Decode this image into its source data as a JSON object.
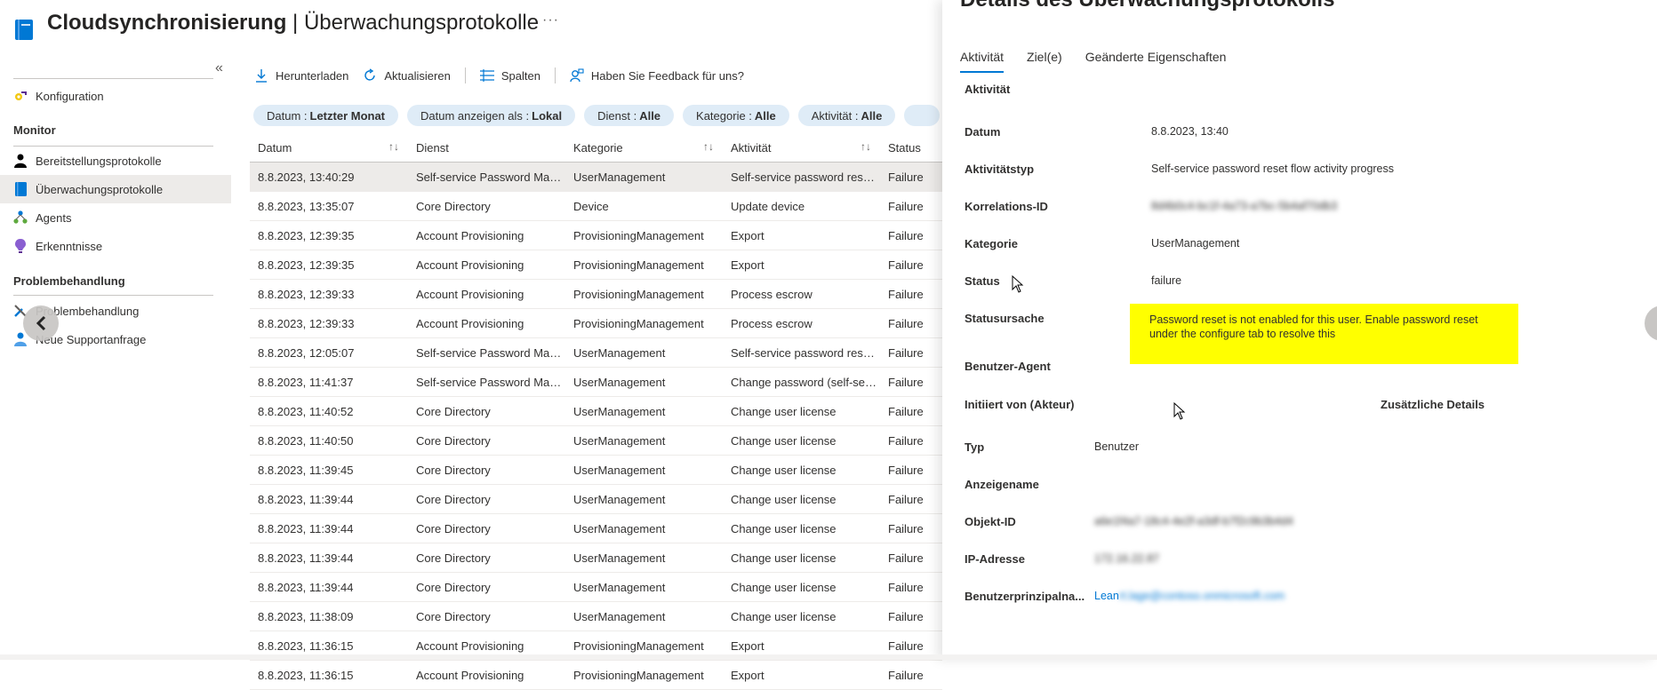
{
  "header": {
    "title_bold": "Cloudsynchronisierung",
    "title_sep": " | ",
    "title_rest": "Überwachungsprotokolle",
    "more": "···"
  },
  "nav": {
    "collapse": "«",
    "items_top": [
      {
        "label": "Konfiguration",
        "icon": "gear-key-icon"
      }
    ],
    "monitor_head": "Monitor",
    "monitor_items": [
      {
        "label": "Bereitstellungsprotokolle",
        "icon": "person-icon"
      },
      {
        "label": "Überwachungsprotokolle",
        "icon": "book-icon",
        "active": true
      },
      {
        "label": "Agents",
        "icon": "agents-icon"
      },
      {
        "label": "Erkenntnisse",
        "icon": "lightbulb-icon"
      }
    ],
    "trouble_head": "Problembehandlung",
    "trouble_items": [
      {
        "label": "Problembehandlung",
        "icon": "wrench-icon"
      },
      {
        "label": "Neue Supportanfrage",
        "icon": "support-person-icon"
      }
    ]
  },
  "toolbar": {
    "download": "Herunterladen",
    "refresh": "Aktualisieren",
    "columns": "Spalten",
    "feedback": "Haben Sie Feedback für uns?"
  },
  "filters": [
    {
      "key": "Datum : ",
      "value": "Letzter Monat"
    },
    {
      "key": "Datum anzeigen als : ",
      "value": "Lokal"
    },
    {
      "key": "Dienst : ",
      "value": "Alle"
    },
    {
      "key": "Kategorie : ",
      "value": "Alle"
    },
    {
      "key": "Aktivität : ",
      "value": "Alle"
    }
  ],
  "table": {
    "headers": [
      "Datum",
      "Dienst",
      "Kategorie",
      "Aktivität",
      "Status"
    ],
    "rows": [
      [
        "8.8.2023, 13:40:29",
        "Self-service Password Mana...",
        "UserManagement",
        "Self-service password reset...",
        "Failure"
      ],
      [
        "8.8.2023, 13:35:07",
        "Core Directory",
        "Device",
        "Update device",
        "Failure"
      ],
      [
        "8.8.2023, 12:39:35",
        "Account Provisioning",
        "ProvisioningManagement",
        "Export",
        "Failure"
      ],
      [
        "8.8.2023, 12:39:35",
        "Account Provisioning",
        "ProvisioningManagement",
        "Export",
        "Failure"
      ],
      [
        "8.8.2023, 12:39:33",
        "Account Provisioning",
        "ProvisioningManagement",
        "Process escrow",
        "Failure"
      ],
      [
        "8.8.2023, 12:39:33",
        "Account Provisioning",
        "ProvisioningManagement",
        "Process escrow",
        "Failure"
      ],
      [
        "8.8.2023, 12:05:07",
        "Self-service Password Mana...",
        "UserManagement",
        "Self-service password reset...",
        "Failure"
      ],
      [
        "8.8.2023, 11:41:37",
        "Self-service Password Mana...",
        "UserManagement",
        "Change password (self-serv...",
        "Failure"
      ],
      [
        "8.8.2023, 11:40:52",
        "Core Directory",
        "UserManagement",
        "Change user license",
        "Failure"
      ],
      [
        "8.8.2023, 11:40:50",
        "Core Directory",
        "UserManagement",
        "Change user license",
        "Failure"
      ],
      [
        "8.8.2023, 11:39:45",
        "Core Directory",
        "UserManagement",
        "Change user license",
        "Failure"
      ],
      [
        "8.8.2023, 11:39:44",
        "Core Directory",
        "UserManagement",
        "Change user license",
        "Failure"
      ],
      [
        "8.8.2023, 11:39:44",
        "Core Directory",
        "UserManagement",
        "Change user license",
        "Failure"
      ],
      [
        "8.8.2023, 11:39:44",
        "Core Directory",
        "UserManagement",
        "Change user license",
        "Failure"
      ],
      [
        "8.8.2023, 11:39:44",
        "Core Directory",
        "UserManagement",
        "Change user license",
        "Failure"
      ],
      [
        "8.8.2023, 11:38:09",
        "Core Directory",
        "UserManagement",
        "Change user license",
        "Failure"
      ],
      [
        "8.8.2023, 11:36:15",
        "Account Provisioning",
        "ProvisioningManagement",
        "Export",
        "Failure"
      ],
      [
        "8.8.2023, 11:36:15",
        "Account Provisioning",
        "ProvisioningManagement",
        "Export",
        "Failure"
      ]
    ]
  },
  "details": {
    "title": "Details des Überwachungsprotokolls",
    "tabs": [
      "Aktivität",
      "Ziel(e)",
      "Geänderte Eigenschaften"
    ],
    "section": "Aktivität",
    "fields": {
      "datum_label": "Datum",
      "datum_value": "8.8.2023, 13:40",
      "typ_label": "Aktivitätstyp",
      "typ_value": "Self-service password reset flow activity progress",
      "korr_label": "Korrelations-ID",
      "korr_value": "8d4b0c4-bc1f-4a73-a7bc-5b4af70db3",
      "kat_label": "Kategorie",
      "kat_value": "UserManagement",
      "status_label": "Status",
      "status_value": "failure",
      "ursache_label": "Statusursache",
      "ursache_value": "Password reset is not enabled for this user. Enable password reset under the configure tab to resolve this",
      "agent_label": "Benutzer-Agent"
    },
    "initiated_head": "Initiiert von (Akteur)",
    "additional_head": "Zusätzliche Details",
    "actor": {
      "typ_label": "Typ",
      "typ_value": "Benutzer",
      "name_label": "Anzeigename",
      "obj_label": "Objekt-ID",
      "obj_value": "a6e1f4a7-18c4-4e2f-a3df-b7f2c9b3b4d4",
      "ip_label": "IP-Adresse",
      "ip_value": "172.16.22.87",
      "upn_label": "Benutzerprinzipalna...",
      "upn_value_visible": "Lean",
      "upn_value_blurred": "rt.lage@contoso.onmicrosoft.com"
    }
  }
}
